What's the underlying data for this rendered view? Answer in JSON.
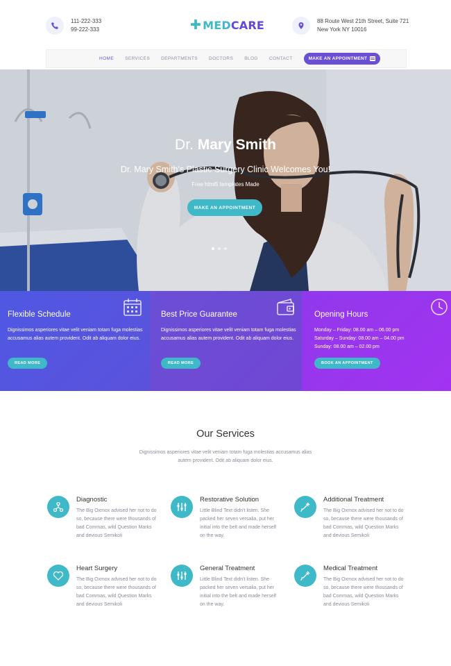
{
  "header": {
    "phone_1": "111-222-333",
    "phone_2": "99-222-333",
    "logo_plus": "✚",
    "logo_med": "MED",
    "logo_care": "CARE",
    "address_1": "88 Route West 21th Street, Suite 721",
    "address_2": "New York NY 10016"
  },
  "nav": {
    "items": [
      "HOME",
      "SERVICES",
      "DEPARTMENTS",
      "DOCTORS",
      "BLOG",
      "CONTACT"
    ],
    "cta": "MAKE AN APPOINTMENT"
  },
  "hero": {
    "title_prefix": "Dr.",
    "title_name": "Mary Smith",
    "subtitle": "Dr. Mary Smith's Plastic Surgery Clinic Welcomes You!",
    "tagline": "Free html5 templates Made",
    "button": "MAKE AN APPOINTMENT"
  },
  "info_boxes": [
    {
      "title": "Flexible Schedule",
      "text": "Dignissimos asperiores vitae velit veniam totam fuga molestias accusamus alias autem provident. Odit ab aliquam dolor eius.",
      "button": "READ MORE",
      "icon": "calendar-icon"
    },
    {
      "title": "Best Price Guarantee",
      "text": "Dignissimos asperiores vitae velit veniam totam fuga molestias accusamus alias autem provident. Odit ab aliquam dolor eius.",
      "button": "READ MORE",
      "icon": "wallet-icon"
    },
    {
      "title": "Opening Hours",
      "line_1": "Monday – Friday: 08.00 am – 06.00 pm",
      "line_2": "Saturday – Sunday: 08.00 am – 04.00 pm",
      "line_3": "Sunday: 08.00 am – 02.00 pm",
      "button": "BOOK AN APPOINTMENT",
      "icon": "clock-icon"
    }
  ],
  "services": {
    "title": "Our Services",
    "intro": "Dignissimos asperiores vitae velit veniam totam fuga molestias accusamus alias autem provident. Odit ab aliquam dolor eius.",
    "items": [
      {
        "title": "Diagnostic",
        "text": "The Big Oxmox advised her not to do so, because there were thousands of bad Commas, wild Question Marks and devious Semikoli",
        "icon": "network-icon"
      },
      {
        "title": "Restorative Solution",
        "text": "Little Blind Text didn't listen. She packed her seven versalia, put her initial into the belt and made herself on the way.",
        "icon": "sliders-icon"
      },
      {
        "title": "Additional Treatment",
        "text": "The Big Oxmox advised her not to do so, because there were thousands of bad Commas, wild Question Marks and devious Semikoli",
        "icon": "syringe-icon"
      },
      {
        "title": "Heart Surgery",
        "text": "The Big Oxmox advised her not to do so, because there were thousands of bad Commas, wild Question Marks and devious Semikoli",
        "icon": "heart-icon"
      },
      {
        "title": "General Treatment",
        "text": "Little Blind Text didn't listen. She packed her seven versalia, put her initial into the belt and made herself on the way.",
        "icon": "sliders-icon"
      },
      {
        "title": "Medical Treatment",
        "text": "The Big Oxmox advised her not to do so, because there were thousands of bad Commas, wild Question Marks and devious Semikoli",
        "icon": "syringe-icon"
      }
    ]
  },
  "colors": {
    "accent_teal": "#3fb8c7",
    "brand_purple": "#6247d8",
    "box_blue": "#5358e0",
    "box_violet": "#6e4bd5",
    "box_purple": "#9a35ee"
  }
}
